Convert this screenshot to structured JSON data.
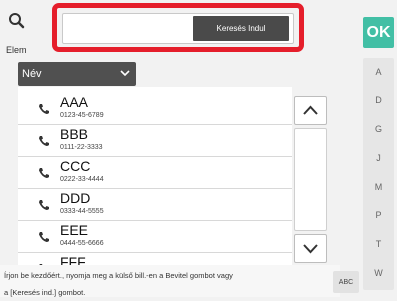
{
  "header": {
    "elem_label": "Elem",
    "search": {
      "value": "",
      "placeholder": "",
      "button_label": "Keresés Indul"
    },
    "ok_label": "OK"
  },
  "filter": {
    "selected": "Név"
  },
  "contacts": [
    {
      "name": "AAA",
      "number": "0123-45-6789"
    },
    {
      "name": "BBB",
      "number": "0111-22-3333"
    },
    {
      "name": "CCC",
      "number": "0222-33-4444"
    },
    {
      "name": "DDD",
      "number": "0333-44-5555"
    },
    {
      "name": "EEE",
      "number": "0444-55-6666"
    },
    {
      "name": "FFF",
      "number": ""
    }
  ],
  "hint": {
    "line1": "Írjon be kezdőért., nyomja meg a külső bill.-en a Bevitel gombot vagy",
    "line2": "a [Keresés ind.] gombot."
  },
  "abc_label": "ABC",
  "index": [
    "A",
    "D",
    "G",
    "J",
    "M",
    "P",
    "T",
    "W"
  ],
  "colors": {
    "accent": "#42bfa5",
    "highlight": "#e51e2b",
    "dark": "#4a4a4a"
  },
  "icons": [
    "search-icon",
    "chevron-down-icon",
    "phone-icon",
    "chevron-up-icon"
  ]
}
